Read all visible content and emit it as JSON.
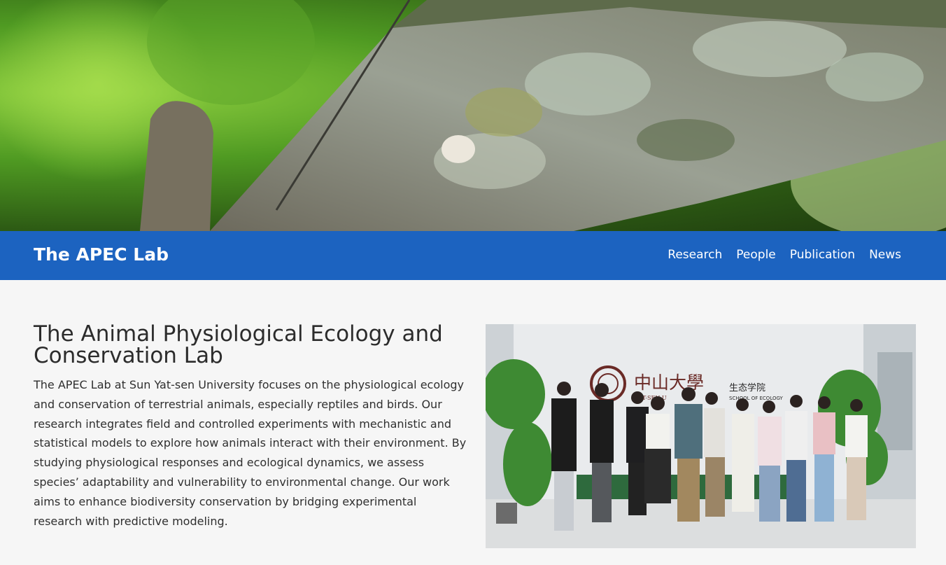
{
  "brand": "The APEC Lab",
  "nav": {
    "items": [
      {
        "label": "Research"
      },
      {
        "label": "People"
      },
      {
        "label": "Publication"
      },
      {
        "label": "News"
      }
    ]
  },
  "main": {
    "heading": "The Animal Physiological Ecology and Conservation Lab",
    "paragraph": "The APEC Lab at Sun Yat-sen University focuses on the physiological ecology and conservation of terrestrial animals, especially reptiles and birds. Our research integrates field and controlled experiments with mechanistic and statistical models to explore how animals interact with their environment. By studying physiological responses and ecological dynamics, we assess species’  adaptability and vulnerability to environmental change. Our work aims to enhance biodiversity conservation by bridging experimental research with predictive modeling."
  },
  "photo": {
    "sign_chinese": "中山大學",
    "sign_school": "生态学院",
    "sign_english_1": "YAT-SEN U",
    "sign_english_2": "SCHOOL OF ECOLOGY"
  },
  "colors": {
    "navbar": "#1c63c0",
    "background": "#f6f6f6"
  }
}
